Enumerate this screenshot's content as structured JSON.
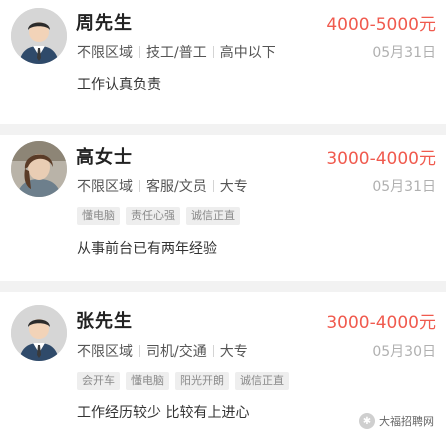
{
  "listings": [
    {
      "name": "周先生",
      "salary": "4000-5000元",
      "meta": [
        "不限区域",
        "技工/普工",
        "高中以下"
      ],
      "date": "05月31日",
      "tags": [],
      "description": "工作认真负责",
      "avatar_icon": "male-avatar-icon"
    },
    {
      "name": "高女士",
      "salary": "3000-4000元",
      "meta": [
        "不限区域",
        "客服/文员",
        "大专"
      ],
      "date": "05月31日",
      "tags": [
        "懂电脑",
        "责任心强",
        "诚信正直"
      ],
      "description": "从事前台已有两年经验",
      "avatar_icon": "user-photo-avatar"
    },
    {
      "name": "张先生",
      "salary": "3000-4000元",
      "meta": [
        "不限区域",
        "司机/交通",
        "大专"
      ],
      "date": "05月30日",
      "tags": [
        "会开车",
        "懂电脑",
        "阳光开朗",
        "诚信正直"
      ],
      "description": "工作经历较少 比较有上进心",
      "avatar_icon": "male-avatar-icon"
    }
  ],
  "watermark": {
    "text": "大福招聘网",
    "icon": "wechat-icon"
  },
  "colors": {
    "salary": "#f05a4e",
    "date": "#b0b0b0",
    "tag_bg": "#eeeeee",
    "page_bg": "#f2f2f2"
  }
}
